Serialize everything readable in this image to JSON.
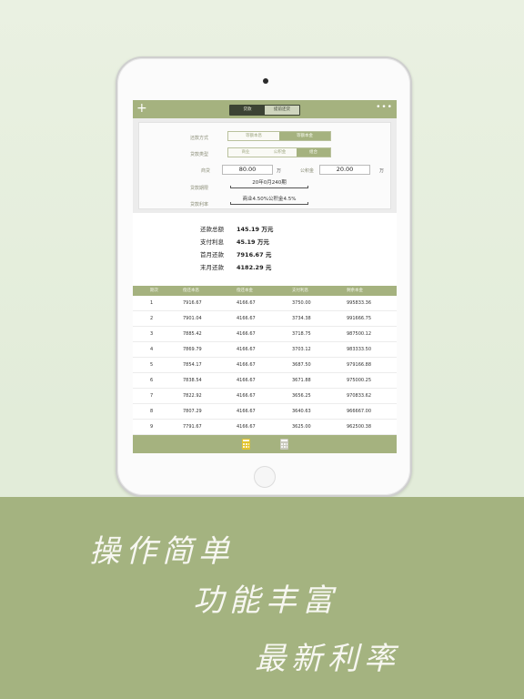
{
  "topbar": {
    "tabs": [
      {
        "label": "贷款",
        "active": true
      },
      {
        "label": "提前还贷",
        "active": false
      }
    ]
  },
  "form": {
    "repay_method_label": "还款方式",
    "repay_options": [
      {
        "label": "等额本息",
        "active": false
      },
      {
        "label": "等额本金",
        "active": true
      }
    ],
    "loan_type_label": "贷款类型",
    "loan_type_options": [
      {
        "label": "商业",
        "active": false
      },
      {
        "label": "公积金",
        "active": false
      },
      {
        "label": "组合",
        "active": true
      }
    ],
    "commercial_label": "商贷",
    "commercial_value": "80.00",
    "commercial_unit": "万",
    "fund_label": "公积金",
    "fund_value": "20.00",
    "fund_unit": "万",
    "term_label": "贷款期限",
    "term_value": "20年0月240期",
    "rate_label": "贷款利率",
    "rate_value": "商业4.50%公积金4.5%"
  },
  "summary": [
    {
      "label": "还款总额",
      "value": "145.19 万元"
    },
    {
      "label": "支付利息",
      "value": "45.19 万元"
    },
    {
      "label": "首月还款",
      "value": "7916.67 元"
    },
    {
      "label": "末月还款",
      "value": "4182.29 元"
    }
  ],
  "table": {
    "headers": [
      "期次",
      "偿还本息",
      "偿还本金",
      "支付利息",
      "剩余本金"
    ],
    "rows": [
      [
        "1",
        "7916.67",
        "4166.67",
        "3750.00",
        "995833.36"
      ],
      [
        "2",
        "7901.04",
        "4166.67",
        "3734.38",
        "991666.75"
      ],
      [
        "3",
        "7885.42",
        "4166.67",
        "3718.75",
        "987500.12"
      ],
      [
        "4",
        "7869.79",
        "4166.67",
        "3703.12",
        "983333.50"
      ],
      [
        "5",
        "7854.17",
        "4166.67",
        "3687.50",
        "979166.88"
      ],
      [
        "6",
        "7838.54",
        "4166.67",
        "3671.88",
        "975000.25"
      ],
      [
        "7",
        "7822.92",
        "4166.67",
        "3656.25",
        "970833.62"
      ],
      [
        "8",
        "7807.29",
        "4166.67",
        "3640.63",
        "966667.00"
      ],
      [
        "9",
        "7791.67",
        "4166.67",
        "3625.00",
        "962500.38"
      ]
    ]
  },
  "bottombar": {
    "icons": [
      "calculator-icon",
      "calculator-icon"
    ]
  },
  "slogans": [
    "操作简单",
    "功能丰富",
    "最新利率"
  ],
  "colors": {
    "accent": "#a5b27f",
    "band": "#a4b380",
    "highlight_icon": "#e3c42c"
  }
}
